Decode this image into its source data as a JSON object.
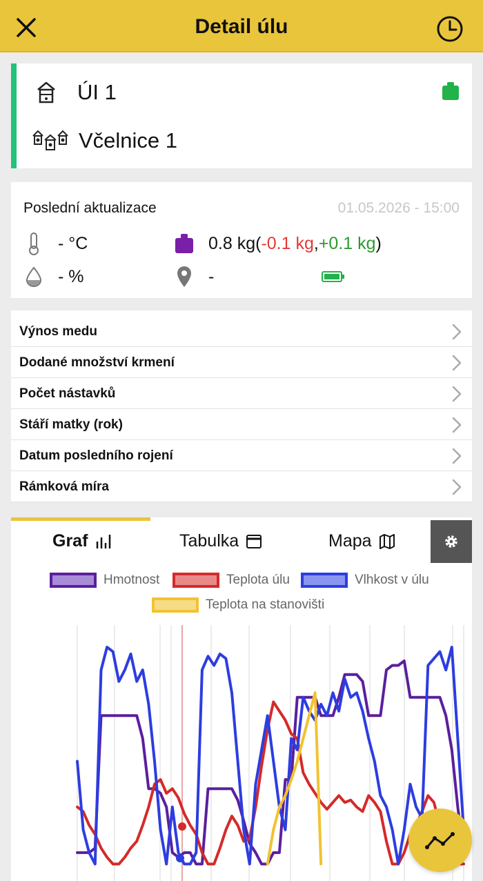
{
  "header": {
    "title": "Detail úlu"
  },
  "hive": {
    "name": "ÚI 1",
    "apiary": "Včelnice 1"
  },
  "update": {
    "label": "Poslední aktualizace",
    "datetime": "01.05.2026 - 15:00",
    "temperature": "- °C",
    "humidity": "- %",
    "weight": "0.8 kg",
    "weight_open": " (",
    "weight_down": "-0.1 kg",
    "weight_sep": ", ",
    "weight_up": "+0.1 kg",
    "weight_close": ")",
    "location": "-"
  },
  "menu": [
    {
      "label": "Výnos medu"
    },
    {
      "label": "Dodané množství krmení"
    },
    {
      "label": "Počet nástavků"
    },
    {
      "label": "Stáří matky (rok)"
    },
    {
      "label": "Datum posledního rojení"
    },
    {
      "label": "Rámková míra"
    }
  ],
  "tabs": [
    {
      "label": "Graf"
    },
    {
      "label": "Tabulka"
    },
    {
      "label": "Mapa"
    }
  ],
  "colors": {
    "accent": "#e9c53c",
    "hive_status": "#22c27a",
    "weight": "#5a1f9e",
    "temp_hive": "#d42a2a",
    "humidity": "#2d3de0",
    "temp_site": "#f2c230"
  },
  "chart_data": {
    "type": "line",
    "series": [
      {
        "name": "Hmotnost",
        "color": "#5a1f9e",
        "fill": "#a98bd8",
        "values": [
          0.1,
          0.1,
          0.1,
          0.12,
          0.7,
          0.7,
          0.7,
          0.7,
          0.7,
          0.7,
          0.7,
          0.6,
          0.38,
          0.38,
          0.36,
          0.3,
          0.1,
          0.08,
          0.1,
          0.1,
          0.05,
          0.05,
          0.38,
          0.38,
          0.38,
          0.38,
          0.38,
          0.33,
          0.24,
          0.14,
          0.1,
          0.05,
          0.05,
          0.1,
          0.1,
          0.42,
          0.42,
          0.78,
          0.78,
          0.78,
          0.78,
          0.7,
          0.7,
          0.7,
          0.78,
          0.88,
          0.88,
          0.88,
          0.85,
          0.7,
          0.7,
          0.7,
          0.9,
          0.92,
          0.92,
          0.94,
          0.78,
          0.78,
          0.78,
          0.78,
          0.78,
          0.78,
          0.7,
          0.55,
          0.3,
          0.1
        ]
      },
      {
        "name": "Teplota úlu",
        "color": "#d42a2a",
        "fill": "#e88a8a",
        "values": [
          0.3,
          0.28,
          0.22,
          0.18,
          0.12,
          0.08,
          0.05,
          0.05,
          0.08,
          0.12,
          0.15,
          0.22,
          0.3,
          0.4,
          0.42,
          0.36,
          0.38,
          0.34,
          0.27,
          0.22,
          0.18,
          0.1,
          0.05,
          0.05,
          0.12,
          0.2,
          0.26,
          0.22,
          0.15,
          0.16,
          0.3,
          0.48,
          0.64,
          0.76,
          0.72,
          0.68,
          0.62,
          0.6,
          0.45,
          0.4,
          0.36,
          0.32,
          0.29,
          0.32,
          0.35,
          0.32,
          0.33,
          0.3,
          0.28,
          0.35,
          0.32,
          0.28,
          0.15,
          0.05,
          0.05,
          0.1,
          0.18,
          0.22,
          0.28,
          0.35,
          0.32,
          0.22,
          0.12,
          0.05,
          0.05,
          0.05
        ]
      },
      {
        "name": "Vlhkost v úlu",
        "color": "#2d3de0",
        "fill": "#8a95f0",
        "values": [
          0.5,
          0.2,
          0.1,
          0.05,
          0.9,
          1.0,
          0.98,
          0.85,
          0.9,
          0.97,
          0.85,
          0.9,
          0.75,
          0.5,
          0.2,
          0.05,
          0.3,
          0.1,
          0.05,
          0.05,
          0.1,
          0.9,
          0.96,
          0.92,
          0.97,
          0.95,
          0.8,
          0.5,
          0.2,
          0.05,
          0.4,
          0.55,
          0.7,
          0.5,
          0.3,
          0.2,
          0.6,
          0.55,
          0.78,
          0.72,
          0.68,
          0.75,
          0.7,
          0.8,
          0.72,
          0.86,
          0.78,
          0.8,
          0.72,
          0.6,
          0.5,
          0.35,
          0.3,
          0.2,
          0.05,
          0.2,
          0.4,
          0.3,
          0.25,
          0.92,
          0.95,
          0.98,
          0.9,
          1.0,
          0.6,
          0.2
        ]
      },
      {
        "name": "Teplota na stanovišti",
        "color": "#f2c230",
        "fill": "#f7dc88",
        "values": [
          null,
          null,
          null,
          null,
          null,
          null,
          null,
          null,
          null,
          null,
          null,
          null,
          null,
          null,
          null,
          null,
          null,
          null,
          null,
          null,
          null,
          null,
          null,
          null,
          null,
          null,
          null,
          null,
          null,
          null,
          null,
          null,
          0.05,
          0.2,
          0.3,
          0.35,
          0.42,
          0.5,
          0.6,
          0.7,
          0.8,
          0.05,
          null,
          null,
          null,
          null,
          null,
          null,
          null,
          null,
          null,
          null,
          null,
          null,
          null,
          null,
          null,
          null,
          null,
          null,
          null,
          null,
          null,
          null,
          null,
          null
        ]
      }
    ],
    "legend_position": "top",
    "grid": true
  }
}
